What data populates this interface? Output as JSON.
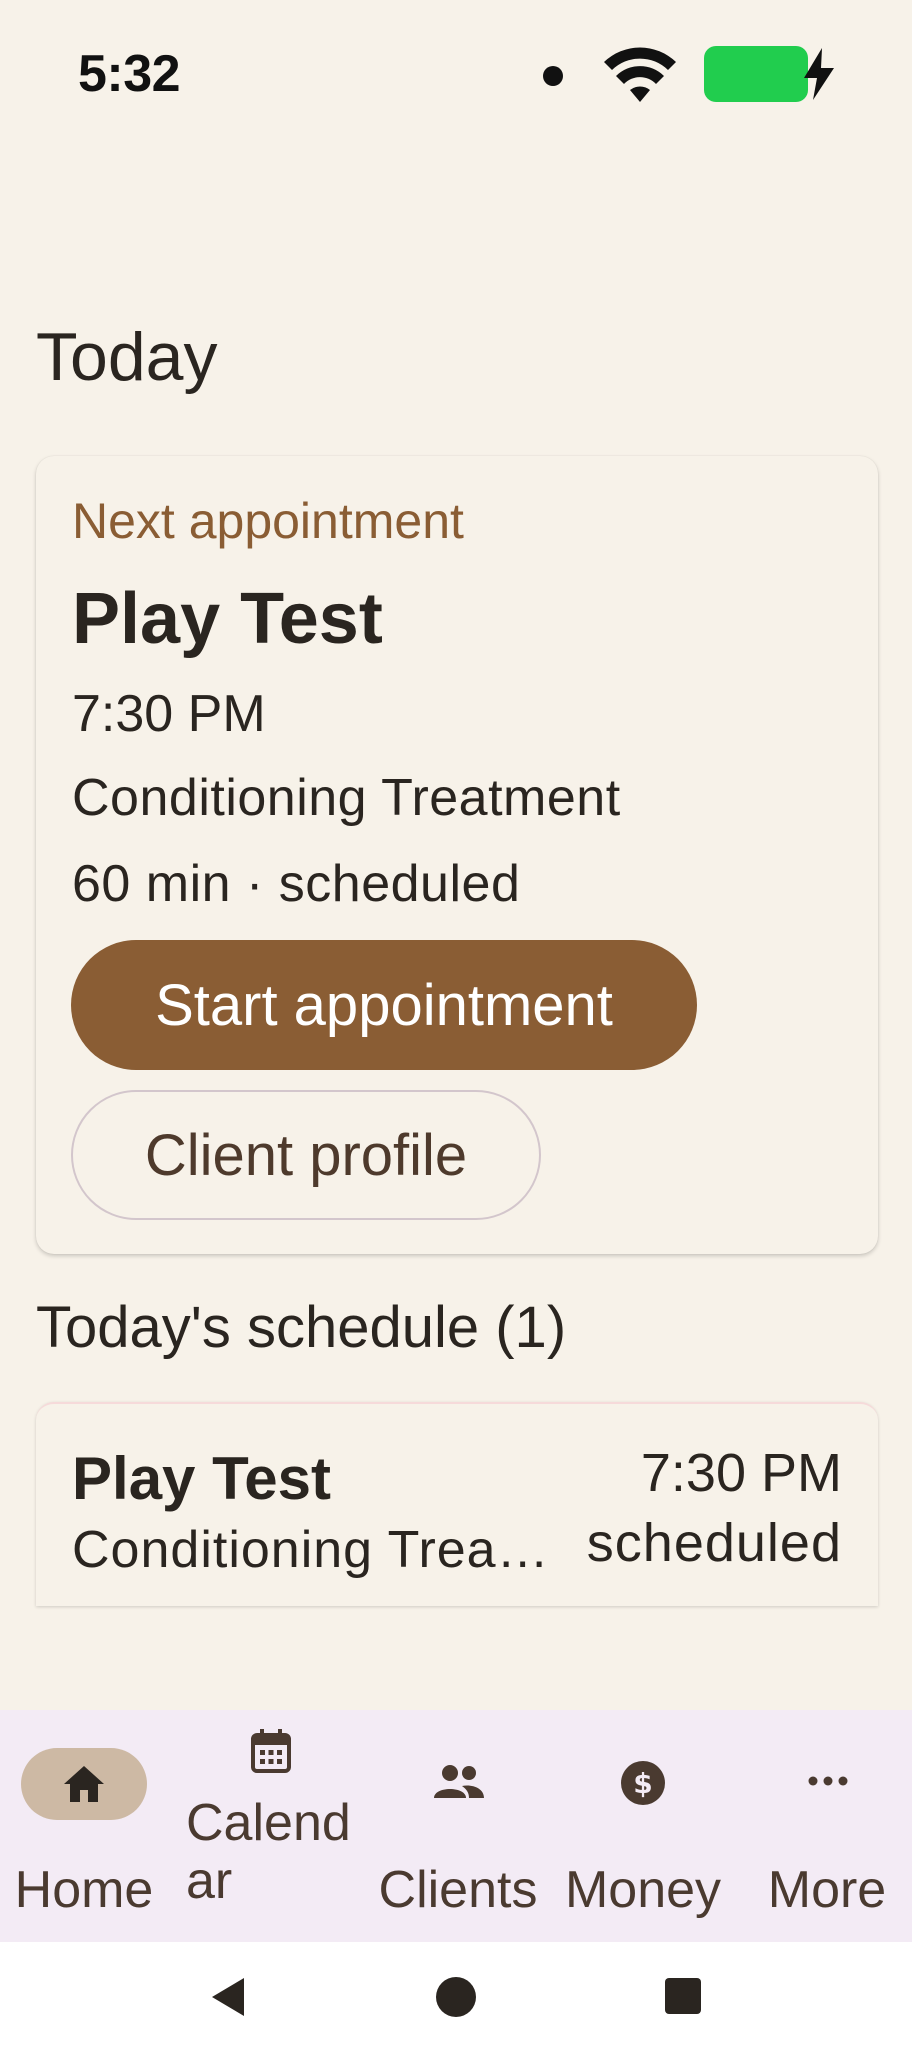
{
  "status_bar": {
    "time": "5:32"
  },
  "page": {
    "title": "Today"
  },
  "next_appointment": {
    "eyebrow": "Next appointment",
    "client": "Play Test",
    "time": "7:30 PM",
    "service": "Conditioning Treatment",
    "meta": "60 min · scheduled",
    "start_label": "Start appointment",
    "profile_label": "Client profile"
  },
  "schedule": {
    "title": "Today's schedule (1)",
    "items": [
      {
        "client": "Play Test",
        "service": "Conditioning Treatment",
        "time": "7:30 PM",
        "status": "scheduled"
      }
    ]
  },
  "bottom_nav": {
    "items": [
      {
        "label": "Home",
        "icon": "home-icon",
        "active": true
      },
      {
        "label": "Calend\nar",
        "icon": "calendar-icon"
      },
      {
        "label": "Clients",
        "icon": "people-icon"
      },
      {
        "label": "Money",
        "icon": "dollar-icon"
      },
      {
        "label": "More",
        "icon": "more-icon"
      }
    ]
  },
  "colors": {
    "background": "#f7f2e9",
    "accent": "#8a5d34",
    "nav_background": "#f3ebf5",
    "battery": "#21cd4e"
  }
}
